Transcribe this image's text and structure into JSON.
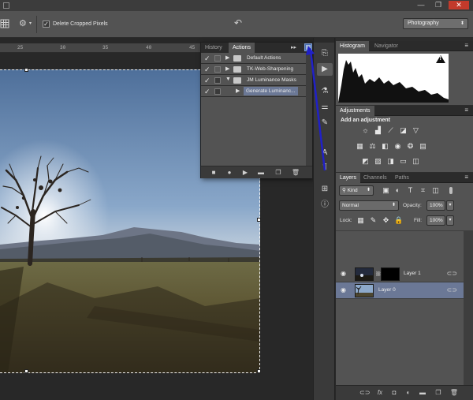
{
  "window": {
    "minimize": "—",
    "restore": "❐",
    "close": "✕"
  },
  "options_bar": {
    "delete_cropped_label": "Delete Cropped Pixels",
    "delete_cropped_checked": "✓",
    "workspace": "Photography"
  },
  "ruler": {
    "ticks": [
      "25",
      "30",
      "35",
      "40",
      "45"
    ]
  },
  "actions_panel": {
    "tabs": [
      "History",
      "Actions"
    ],
    "active_tab": "Actions",
    "rows": [
      {
        "label": "Default Actions",
        "check": "✓",
        "expand": "▶"
      },
      {
        "label": "TK-Web-Sharpening",
        "check": "✓",
        "expand": "▶"
      },
      {
        "label": "JM Luminance Masks",
        "check": "✓",
        "expand": "▼"
      },
      {
        "label": "Generate Luminanc...",
        "check": "✓",
        "expand": "▶"
      }
    ]
  },
  "histogram_panel": {
    "tabs": [
      "Histogram",
      "Navigator"
    ],
    "warning": "!"
  },
  "adjustments_panel": {
    "tab": "Adjustments",
    "heading": "Add an adjustment"
  },
  "layers_panel": {
    "tabs": [
      "Layers",
      "Channels",
      "Paths"
    ],
    "filter_kind": "Kind",
    "blend_mode": "Normal",
    "opacity_label": "Opacity:",
    "opacity_value": "100%",
    "lock_label": "Lock:",
    "fill_label": "Fill:",
    "fill_value": "100%",
    "layers": [
      {
        "name": "Layer 1",
        "selected": false
      },
      {
        "name": "Layer 0",
        "selected": true
      }
    ],
    "footer_fx": "fx"
  },
  "colors": {
    "accent_arrow": "#2020c8",
    "selection": "#6b7896",
    "panel": "#535353"
  }
}
